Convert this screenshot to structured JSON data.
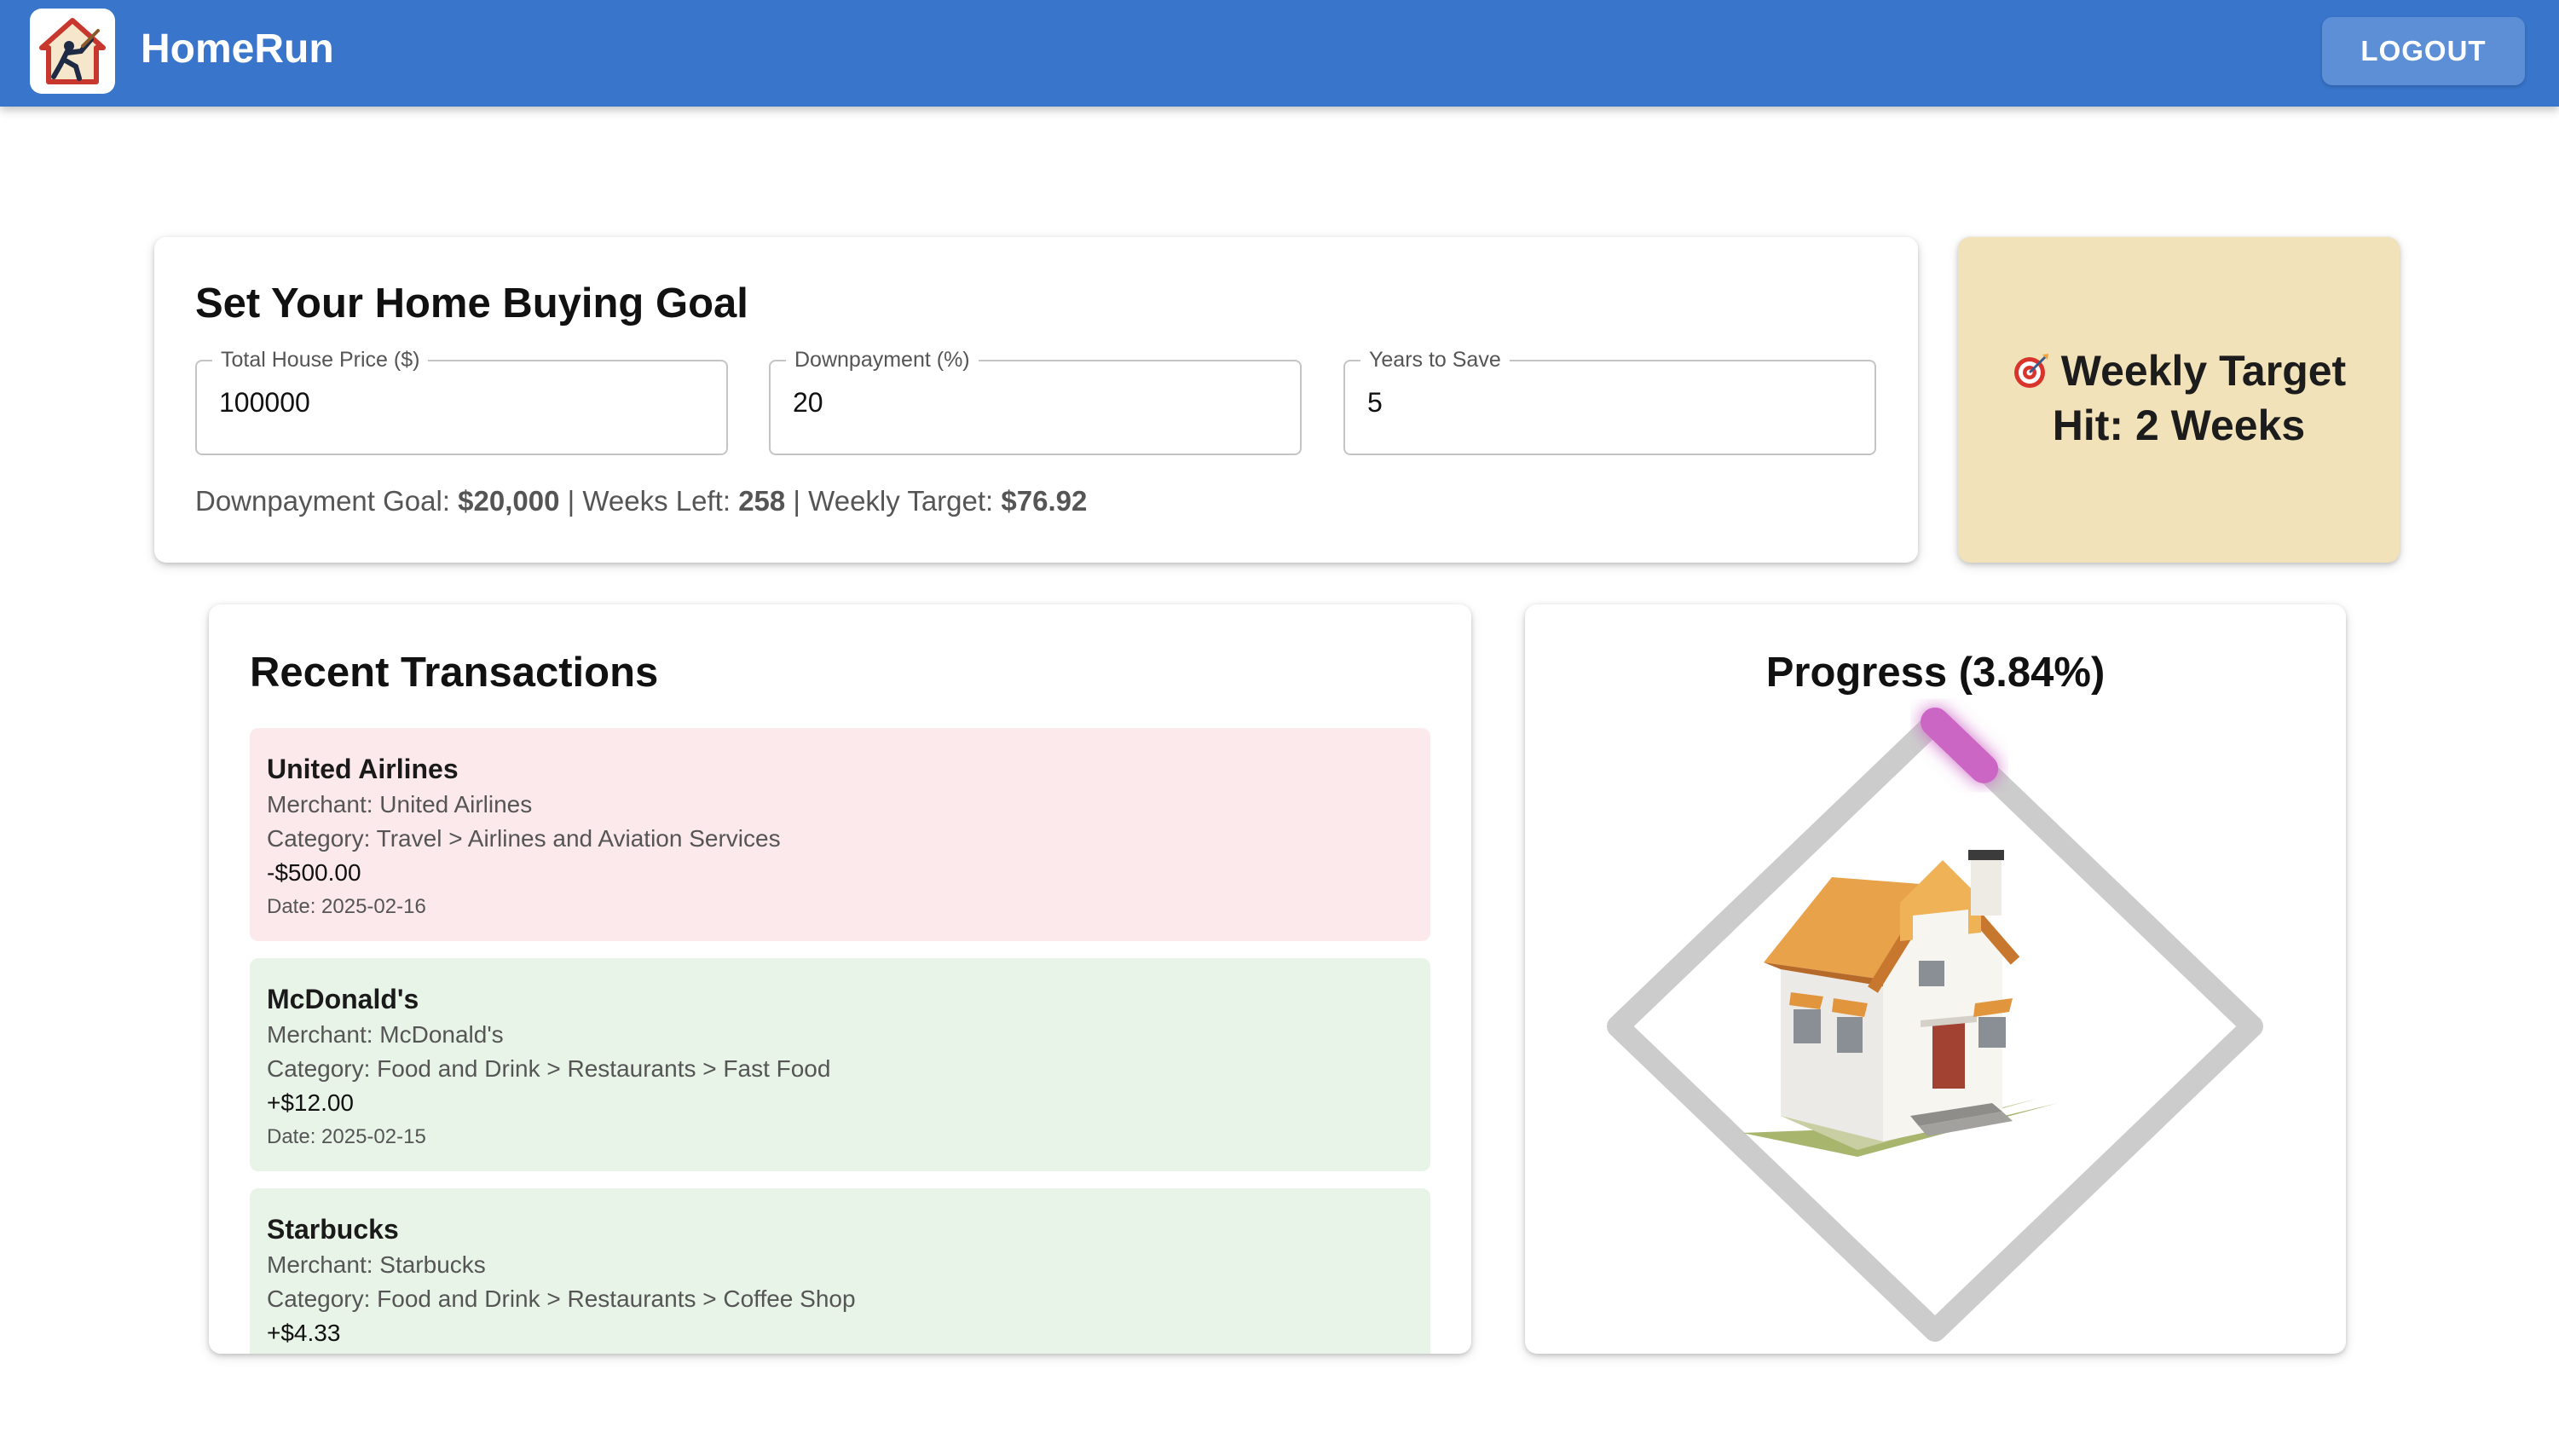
{
  "app": {
    "title": "HomeRun",
    "logout_label": "LOGOUT"
  },
  "goal": {
    "title": "Set Your Home Buying Goal",
    "fields": [
      {
        "label": "Total House Price ($)",
        "value": "100000"
      },
      {
        "label": "Downpayment (%)",
        "value": "20"
      },
      {
        "label": "Years to Save",
        "value": "5"
      }
    ],
    "summary": {
      "goal_label": "Downpayment Goal:",
      "goal_value": "$20,000",
      "sep1": " | ",
      "weeks_label": "Weeks Left:",
      "weeks_value": "258",
      "sep2": " | ",
      "weekly_label": "Weekly Target:",
      "weekly_value": "$76.92"
    }
  },
  "target": {
    "icon": "dart-target-icon",
    "line1": "Weekly Target",
    "line2": "Hit: 2 Weeks"
  },
  "transactions": {
    "title": "Recent Transactions",
    "items": [
      {
        "name": "United Airlines",
        "merchant": "Merchant: United Airlines",
        "category": "Category: Travel > Airlines and Aviation Services",
        "amount": "-$500.00",
        "date": "Date: 2025-02-16",
        "type": "debit"
      },
      {
        "name": "McDonald's",
        "merchant": "Merchant: McDonald's",
        "category": "Category: Food and Drink > Restaurants > Fast Food",
        "amount": "+$12.00",
        "date": "Date: 2025-02-15",
        "type": "credit"
      },
      {
        "name": "Starbucks",
        "merchant": "Merchant: Starbucks",
        "category": "Category: Food and Drink > Restaurants > Coffee Shop",
        "amount": "+$4.33",
        "date": "",
        "type": "credit"
      }
    ]
  },
  "progress": {
    "title": "Progress (3.84%)",
    "percent": 3.84,
    "track_color": "#cccccc",
    "fill_color": "#cc66c4",
    "center_image": "house-illustration"
  },
  "colors": {
    "appbar": "#3875cb",
    "target_card": "#f2e2b9",
    "debit_bg": "#fce9ec",
    "credit_bg": "#e8f4e7"
  }
}
